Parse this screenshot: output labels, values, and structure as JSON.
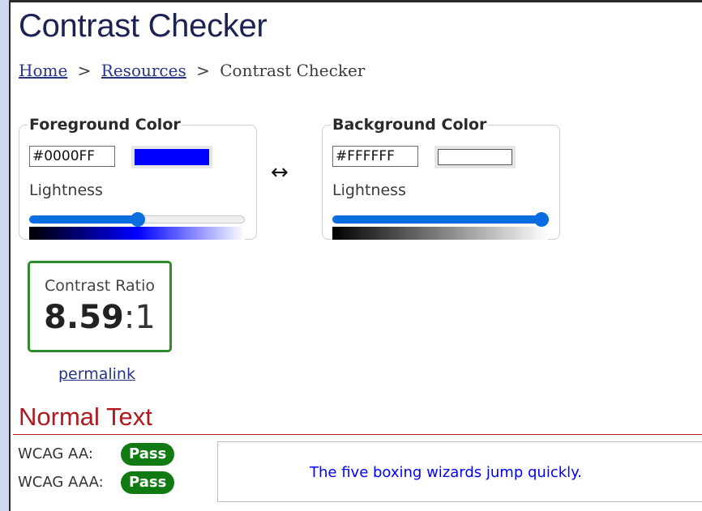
{
  "page": {
    "title": "Contrast Checker"
  },
  "breadcrumb": {
    "home": "Home",
    "sep1": ">",
    "resources": "Resources",
    "sep2": ">",
    "current": "Contrast Checker"
  },
  "foreground": {
    "legend": "Foreground Color",
    "hex": "#0000FF",
    "swatch_color": "#0000FF",
    "lightness_label": "Lightness",
    "lightness_value": 0.5,
    "gradient_from": "#000000",
    "gradient_mid": "#0000FF",
    "gradient_to": "#ffffff"
  },
  "background": {
    "legend": "Background Color",
    "hex": "#FFFFFF",
    "swatch_color": "#FFFFFF",
    "lightness_label": "Lightness",
    "lightness_value": 1.0,
    "gradient_from": "#000000",
    "gradient_to": "#ffffff"
  },
  "swap_icon": "left-right-arrow-icon",
  "swap_glyph": "↔",
  "ratio": {
    "label": "Contrast Ratio",
    "value": "8.59",
    "colon": ":",
    "suffix": "1"
  },
  "permalink": "permalink",
  "normal_text": {
    "heading": "Normal Text",
    "aa_label": "WCAG AA:",
    "aa_status": "Pass",
    "aaa_label": "WCAG AAA:",
    "aaa_status": "Pass",
    "sample": "The five boxing wizards jump quickly."
  },
  "colors": {
    "accent_blue": "#0a6ee0",
    "pass_green": "#127a12",
    "section_red": "#b0191e",
    "title_navy": "#1c2254"
  }
}
